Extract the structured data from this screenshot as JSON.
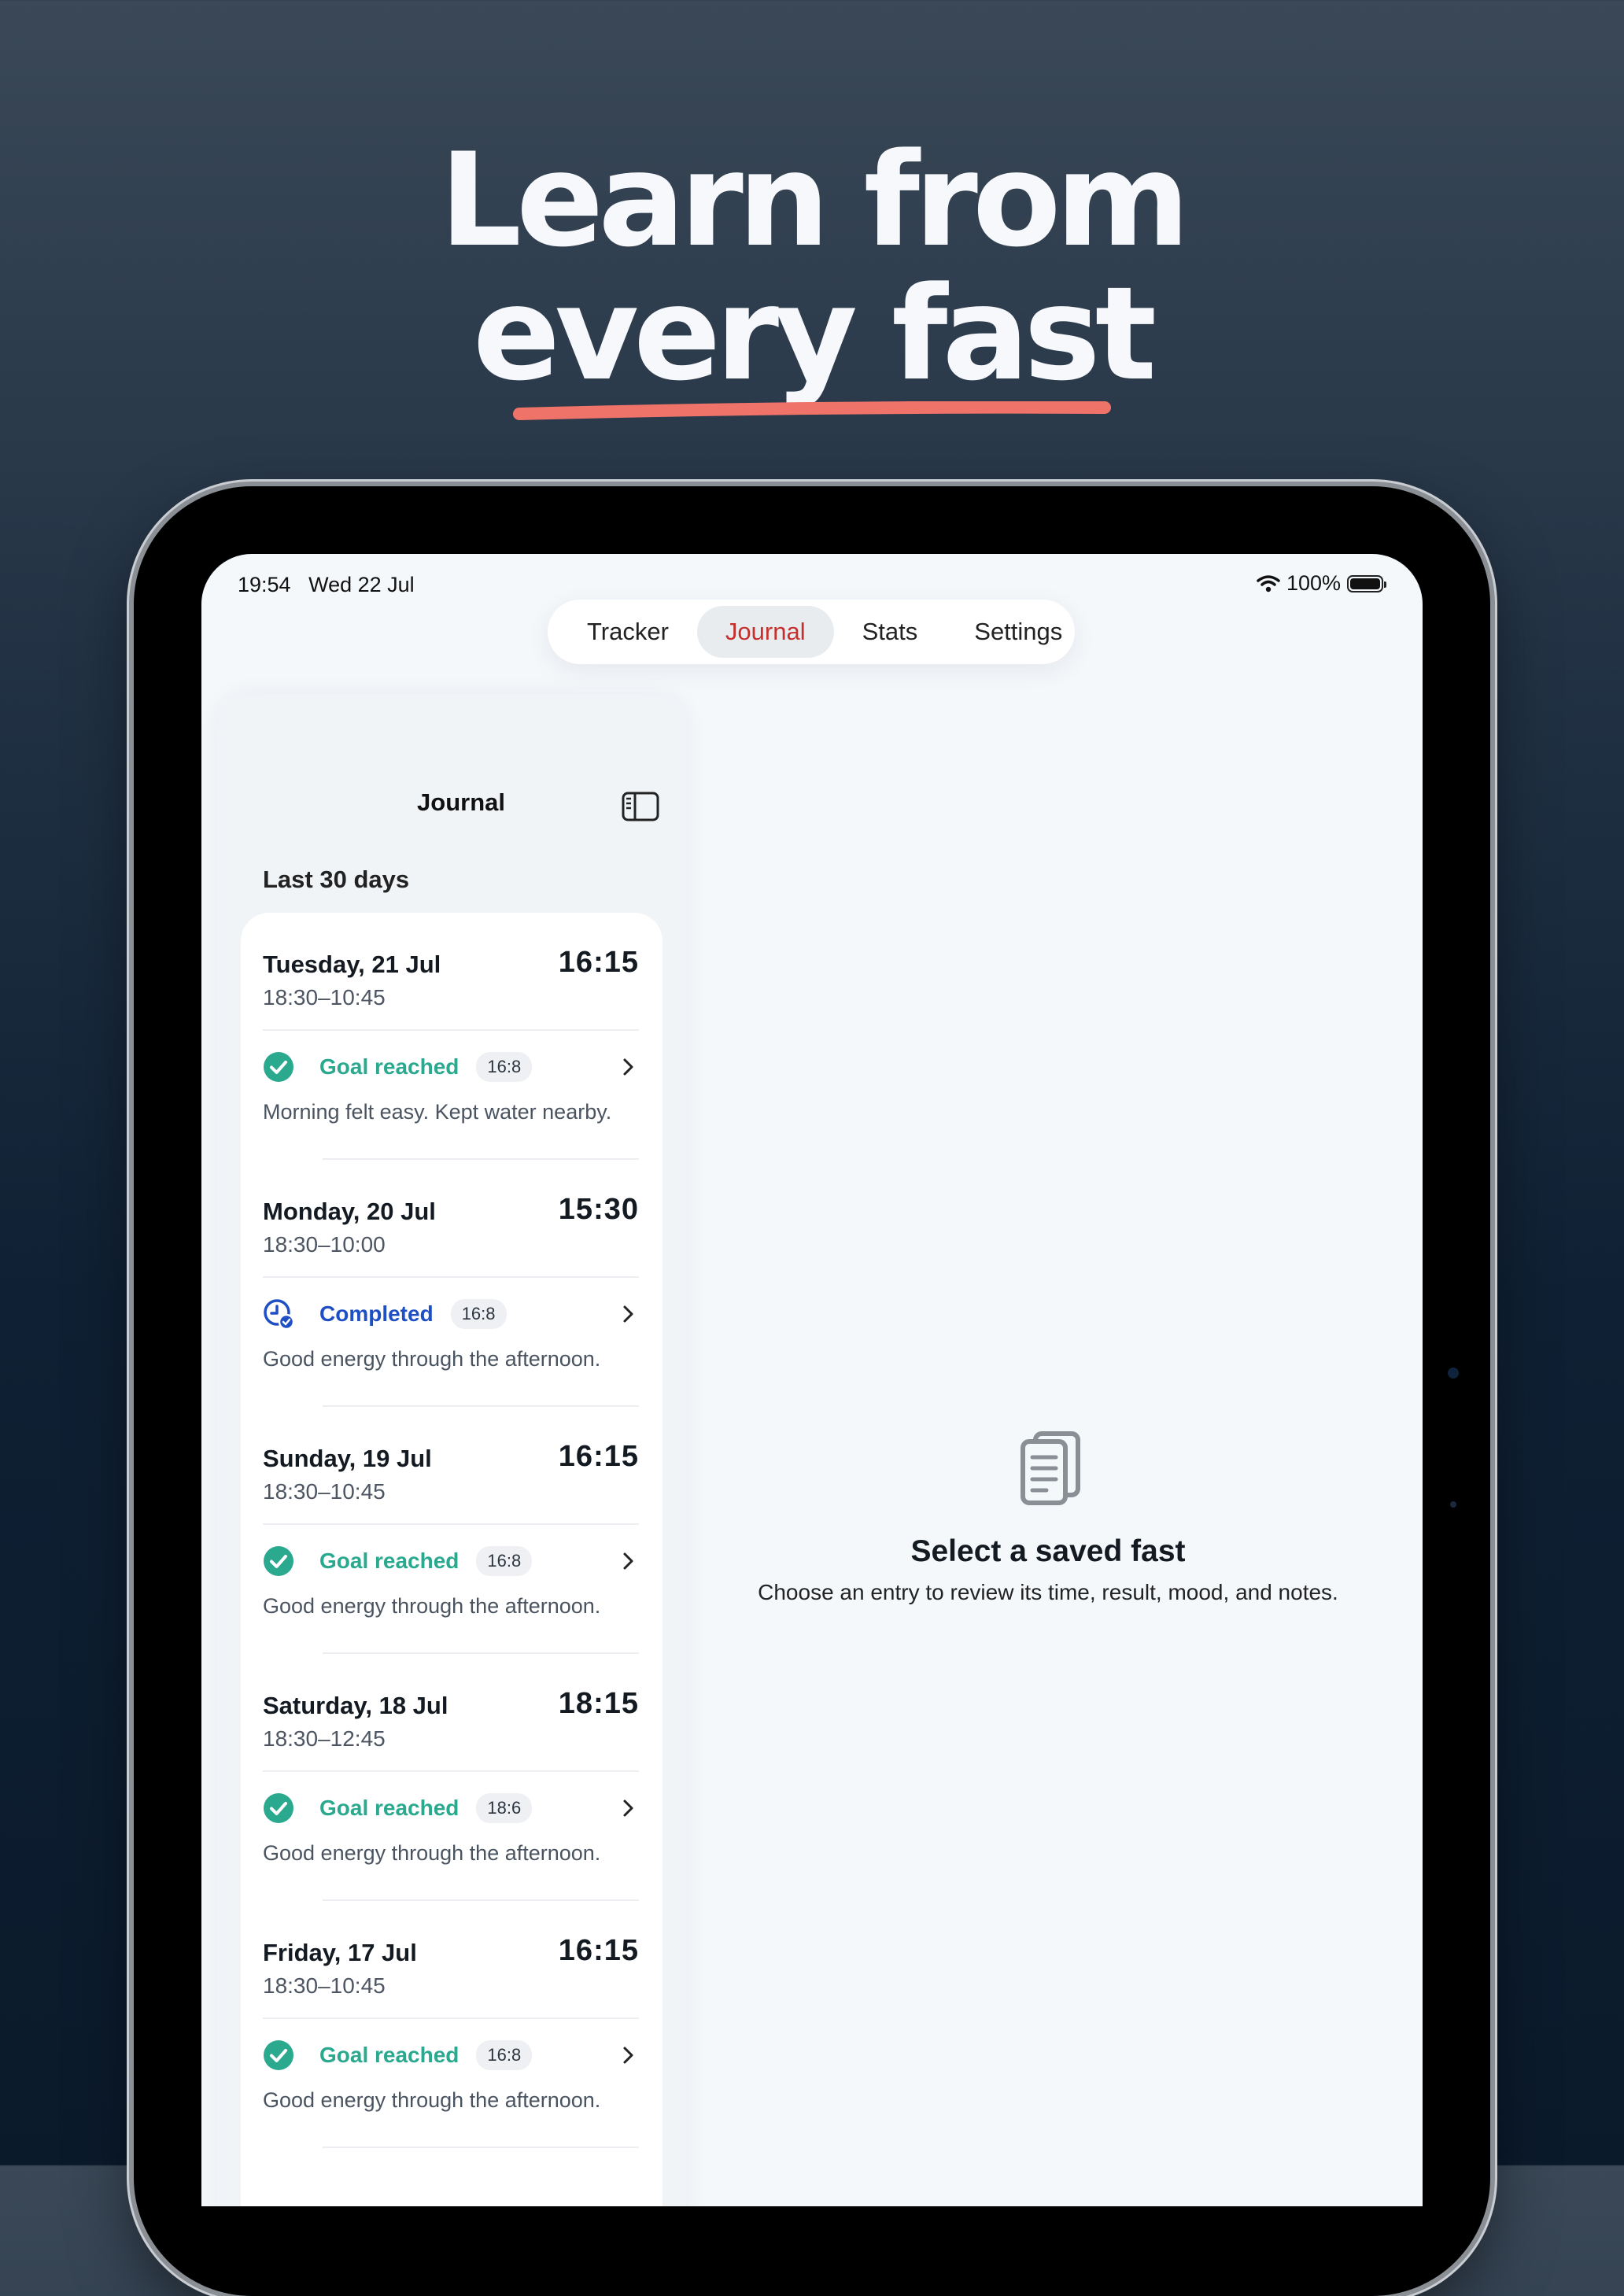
{
  "headline": {
    "line1": "Learn from",
    "line2": "every fast",
    "underline_color": "#f0736a"
  },
  "status_bar": {
    "time": "19:54",
    "date": "Wed 22 Jul",
    "battery": "100%"
  },
  "tabs": [
    {
      "label": "Tracker",
      "active": false
    },
    {
      "label": "Journal",
      "active": true
    },
    {
      "label": "Stats",
      "active": false
    },
    {
      "label": "Settings",
      "active": false
    }
  ],
  "sidebar": {
    "title": "Journal",
    "section": "Last 30 days",
    "entries": [
      {
        "date": "Tuesday, 21 Jul",
        "range": "18:30–10:45",
        "duration": "16:15",
        "status": "Goal reached",
        "status_type": "green",
        "plan": "16:8",
        "note": "Morning felt easy. Kept water nearby."
      },
      {
        "date": "Monday, 20 Jul",
        "range": "18:30–10:00",
        "duration": "15:30",
        "status": "Completed",
        "status_type": "blue",
        "plan": "16:8",
        "note": "Good energy through the afternoon."
      },
      {
        "date": "Sunday, 19 Jul",
        "range": "18:30–10:45",
        "duration": "16:15",
        "status": "Goal reached",
        "status_type": "green",
        "plan": "16:8",
        "note": "Good energy through the afternoon."
      },
      {
        "date": "Saturday, 18 Jul",
        "range": "18:30–12:45",
        "duration": "18:15",
        "status": "Goal reached",
        "status_type": "green",
        "plan": "18:6",
        "note": "Good energy through the afternoon."
      },
      {
        "date": "Friday, 17 Jul",
        "range": "18:30–10:45",
        "duration": "16:15",
        "status": "Goal reached",
        "status_type": "green",
        "plan": "16:8",
        "note": "Good energy through the afternoon."
      }
    ]
  },
  "detail": {
    "title": "Select a saved fast",
    "subtitle": "Choose an entry to review its time, result, mood, and notes."
  },
  "colors": {
    "accent_green": "#2aa98f",
    "accent_blue": "#1f4fc4",
    "active_tab_text": "#c5302c"
  }
}
